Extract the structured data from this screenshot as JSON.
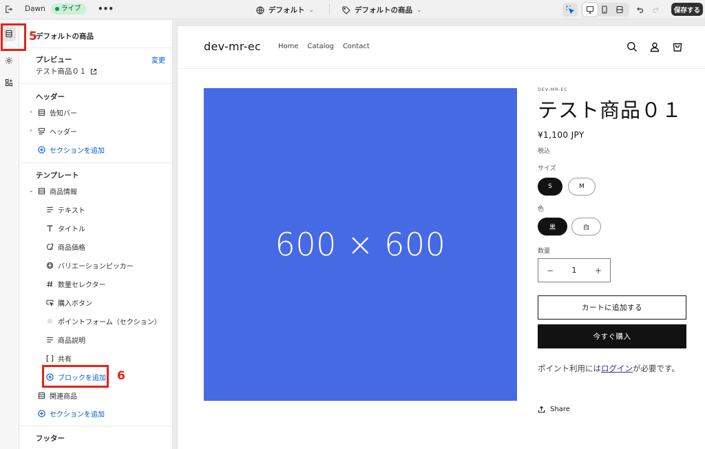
{
  "topbar": {
    "theme_name": "Dawn",
    "live_badge": "ライブ",
    "more": "•••",
    "template_label": "デフォルト",
    "product_label": "デフォルトの商品",
    "save_label": "保存する"
  },
  "panel": {
    "title": "デフォルトの商品",
    "preview_label": "プレビュー",
    "preview_change": "変更",
    "preview_value": "テスト商品０１",
    "header_group": "ヘッダー",
    "header_items": [
      "告知バー",
      "ヘッダー"
    ],
    "add_section": "セクションを追加",
    "template_group": "テンプレート",
    "main_section": "商品情報",
    "blocks": [
      "テキスト",
      "タイトル",
      "商品価格",
      "バリエーションピッカー",
      "数量セレクター",
      "購入ボタン",
      "ポイントフォーム（セクション）",
      "商品説明",
      "共有"
    ],
    "add_block": "ブロックを追加",
    "related": "関連商品",
    "add_section_2": "セクションを追加",
    "footer_group": "フッター"
  },
  "annotations": {
    "step5": "5",
    "step6": "6"
  },
  "preview": {
    "store_name": "dev-mr-ec",
    "nav": [
      "Home",
      "Catalog",
      "Contact"
    ],
    "image_placeholder": "600 × 600",
    "image_color": "#4669e4",
    "vendor": "DEV-MR-EC",
    "title": "テスト商品０１",
    "price": "¥1,100 JPY",
    "tax": "税込",
    "size_label": "サイズ",
    "sizes": [
      "S",
      "M"
    ],
    "selected_size": "S",
    "color_label": "色",
    "colors": [
      "黒",
      "白"
    ],
    "selected_color": "黒",
    "qty_label": "数量",
    "qty_value": "1",
    "qty_minus": "−",
    "qty_plus": "+",
    "add_to_cart": "カートに追加する",
    "buy_now": "今すぐ購入",
    "points_before": "ポイント利用には",
    "points_link": "ログイン",
    "points_after": "が必要です。",
    "share": "Share"
  },
  "colors": {
    "accent_blue": "#005bd3",
    "annotation_red": "#e8210f",
    "live_green": "#c8f2d3"
  }
}
